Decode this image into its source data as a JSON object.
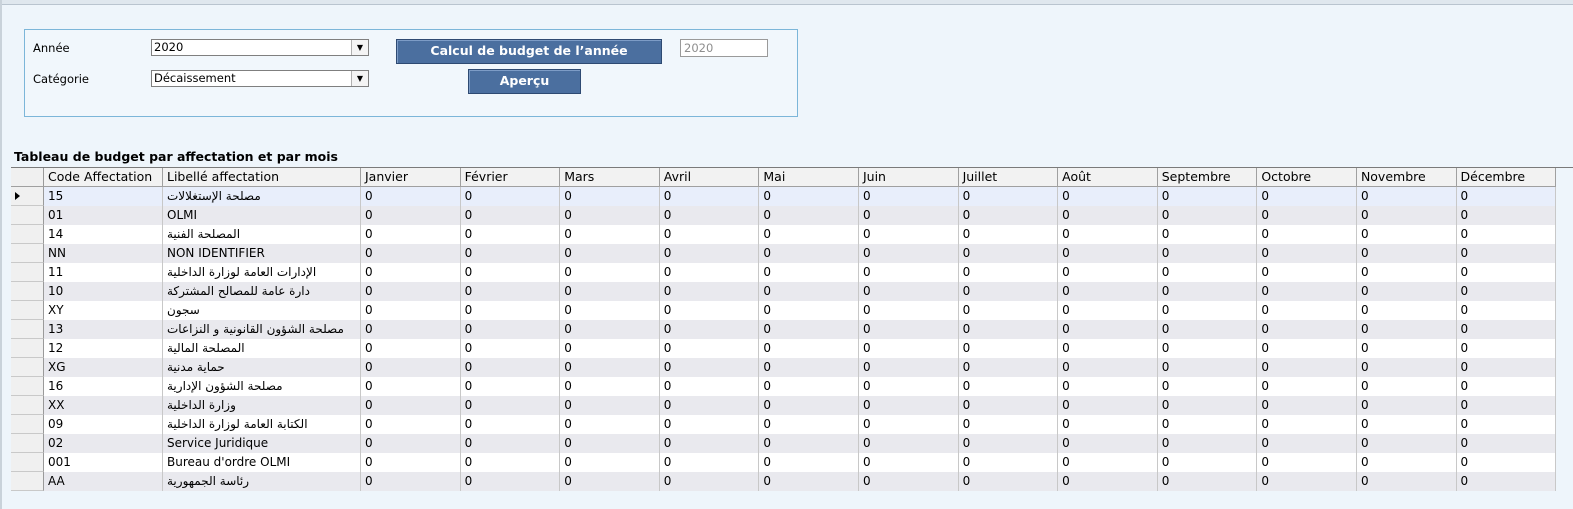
{
  "filters": {
    "year_label": "Année",
    "year_value": "2020",
    "category_label": "Catégorie",
    "category_value": "Décaissement",
    "calc_button": "Calcul de budget de l’année",
    "preview_button": "Aperçu",
    "year_field_value": "2020"
  },
  "table": {
    "title": "Tableau de budget par affectation et par mois",
    "columns": [
      "Code Affectation",
      "Libellé affectation",
      "Janvier",
      "Février",
      "Mars",
      "Avril",
      "Mai",
      "Juin",
      "Juillet",
      "Août",
      "Septembre",
      "Octobre",
      "Novembre",
      "Décembre"
    ],
    "rows": [
      {
        "code": "15",
        "label": "مصلحة الإستغلالات",
        "values": [
          "0",
          "0",
          "0",
          "0",
          "0",
          "0",
          "0",
          "0",
          "0",
          "0",
          "0",
          "0"
        ]
      },
      {
        "code": "01",
        "label": "OLMI",
        "values": [
          "0",
          "0",
          "0",
          "0",
          "0",
          "0",
          "0",
          "0",
          "0",
          "0",
          "0",
          "0"
        ]
      },
      {
        "code": "14",
        "label": "المصلحة الفنية",
        "values": [
          "0",
          "0",
          "0",
          "0",
          "0",
          "0",
          "0",
          "0",
          "0",
          "0",
          "0",
          "0"
        ]
      },
      {
        "code": "NN",
        "label": "NON IDENTIFIER",
        "values": [
          "0",
          "0",
          "0",
          "0",
          "0",
          "0",
          "0",
          "0",
          "0",
          "0",
          "0",
          "0"
        ]
      },
      {
        "code": "11",
        "label": "الإدارات العامة لوزارة الداخلية",
        "values": [
          "0",
          "0",
          "0",
          "0",
          "0",
          "0",
          "0",
          "0",
          "0",
          "0",
          "0",
          "0"
        ]
      },
      {
        "code": "10",
        "label": "دارة عامة للمصالح المشتركة",
        "values": [
          "0",
          "0",
          "0",
          "0",
          "0",
          "0",
          "0",
          "0",
          "0",
          "0",
          "0",
          "0"
        ]
      },
      {
        "code": "XY",
        "label": "سجون",
        "values": [
          "0",
          "0",
          "0",
          "0",
          "0",
          "0",
          "0",
          "0",
          "0",
          "0",
          "0",
          "0"
        ]
      },
      {
        "code": "13",
        "label": "مصلحة الشؤون القانونية و النزاعات",
        "values": [
          "0",
          "0",
          "0",
          "0",
          "0",
          "0",
          "0",
          "0",
          "0",
          "0",
          "0",
          "0"
        ]
      },
      {
        "code": "12",
        "label": "المصلحة المالية",
        "values": [
          "0",
          "0",
          "0",
          "0",
          "0",
          "0",
          "0",
          "0",
          "0",
          "0",
          "0",
          "0"
        ]
      },
      {
        "code": "XG",
        "label": "حماية مدنية",
        "values": [
          "0",
          "0",
          "0",
          "0",
          "0",
          "0",
          "0",
          "0",
          "0",
          "0",
          "0",
          "0"
        ]
      },
      {
        "code": "16",
        "label": "مصلحة الشؤون الإدارية",
        "values": [
          "0",
          "0",
          "0",
          "0",
          "0",
          "0",
          "0",
          "0",
          "0",
          "0",
          "0",
          "0"
        ]
      },
      {
        "code": "XX",
        "label": "وزارة الداخلية",
        "values": [
          "0",
          "0",
          "0",
          "0",
          "0",
          "0",
          "0",
          "0",
          "0",
          "0",
          "0",
          "0"
        ]
      },
      {
        "code": "09",
        "label": "الكتابة العامة لوزارة الداخلية",
        "values": [
          "0",
          "0",
          "0",
          "0",
          "0",
          "0",
          "0",
          "0",
          "0",
          "0",
          "0",
          "0"
        ]
      },
      {
        "code": "02",
        "label": "Service Juridique",
        "values": [
          "0",
          "0",
          "0",
          "0",
          "0",
          "0",
          "0",
          "0",
          "0",
          "0",
          "0",
          "0"
        ]
      },
      {
        "code": "001",
        "label": "Bureau d'ordre OLMI",
        "values": [
          "0",
          "0",
          "0",
          "0",
          "0",
          "0",
          "0",
          "0",
          "0",
          "0",
          "0",
          "0"
        ]
      },
      {
        "code": "AA",
        "label": "رئاسة الجمهورية",
        "values": [
          "0",
          "0",
          "0",
          "0",
          "0",
          "0",
          "0",
          "0",
          "0",
          "0",
          "0",
          "0"
        ]
      }
    ]
  },
  "icons": {
    "dropdown": "chevron-down-icon",
    "row_pointer": "row-pointer-icon"
  }
}
